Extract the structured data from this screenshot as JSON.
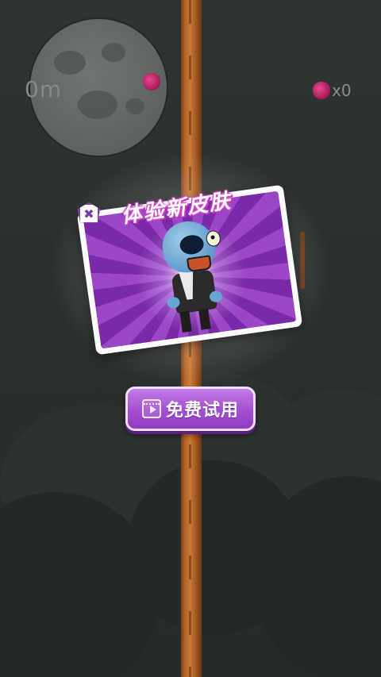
{
  "hud": {
    "distance": "0m",
    "fruit_count": "x0",
    "fruit_icon": "berry-icon"
  },
  "popup": {
    "title": "体验新皮肤",
    "close_icon": "close-icon",
    "character": "blue-zombie-skin",
    "trial_button_label": "免费试用",
    "trial_button_icon": "video-play-icon"
  },
  "colors": {
    "accent": "#a24fd1",
    "background": "#2a302d",
    "trunk": "#b5652a"
  }
}
